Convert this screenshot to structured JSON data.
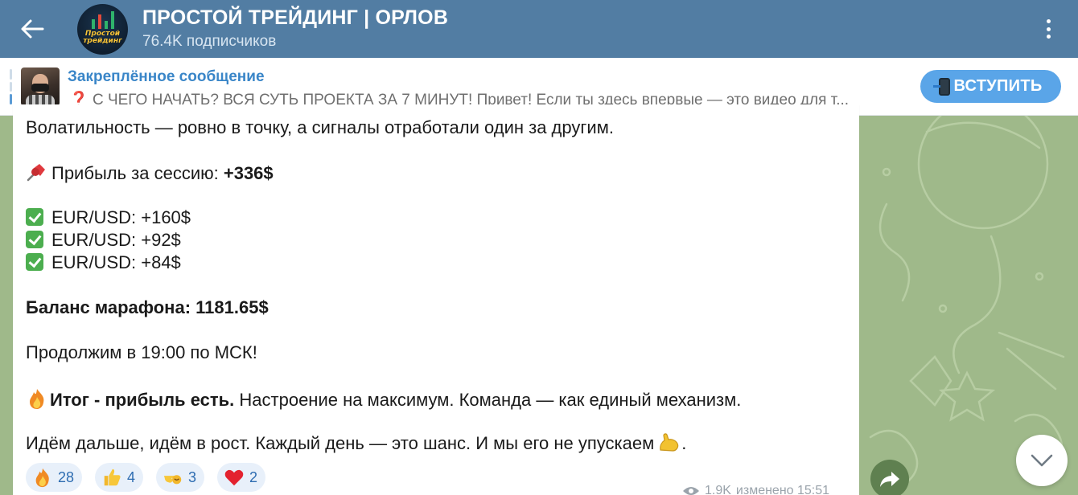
{
  "header": {
    "title": "ПРОСТОЙ ТРЕЙДИНГ | ОРЛОВ",
    "subscribers": "76.4K подписчиков",
    "avatar_text_line1": "Простой",
    "avatar_text_line2": "трейдинг"
  },
  "pinned": {
    "title": "Закреплённое сообщение",
    "question_mark": "❓",
    "text": " С ЧЕГО НАЧАТЬ? ВСЯ СУТЬ ПРОЕКТА ЗА 7 МИНУТ!  Привет! Если ты здесь впервые — это видео для т...",
    "join_label": "ВСТУПИТЬ"
  },
  "message": {
    "line_volatility": "Волатильность — ровно в точку, а сигналы отработали один за другим.",
    "profit_label": "Прибыль за сессию: ",
    "profit_value": "+336$",
    "trades": [
      {
        "text": "EUR/USD: +160$"
      },
      {
        "text": "EUR/USD: +92$"
      },
      {
        "text": "EUR/USD: +84$"
      }
    ],
    "balance": "Баланс марафона: 1181.65$",
    "continue": "Продолжим в 19:00 по МСК!",
    "summary_bold": "Итог - прибыль есть.",
    "summary_rest": " Настроение на максимум. Команда — как единый механизм.",
    "closing": "Идём дальше, идём в рост. Каждый день — это шанс. И мы его не упускаем"
  },
  "reactions": [
    {
      "emoji": "fire",
      "count": "28"
    },
    {
      "emoji": "thumbs-up",
      "count": "4"
    },
    {
      "emoji": "pointing-hand",
      "count": "3"
    },
    {
      "emoji": "heart",
      "count": "2"
    }
  ],
  "meta": {
    "views": "1.9K",
    "edited": "изменено 15:51"
  },
  "colors": {
    "header_bg": "#527da3",
    "accent": "#3a86c8",
    "join_bg": "#5aa5e8",
    "chat_bg": "#9fb98a"
  }
}
